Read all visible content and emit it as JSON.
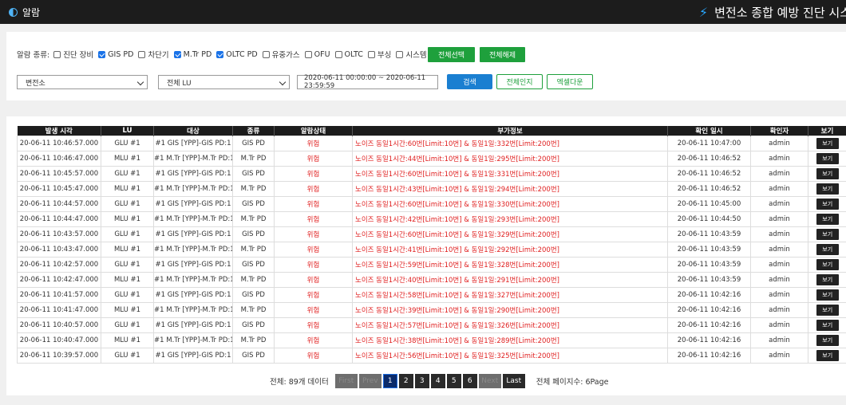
{
  "topbar": {
    "title": "알람",
    "system_title": "변전소 종합 예방 진단 시스"
  },
  "filters": {
    "type_label": "알람 종류:",
    "checkboxes": [
      {
        "label": "진단 장비",
        "checked": false
      },
      {
        "label": "GIS PD",
        "checked": true
      },
      {
        "label": "차단기",
        "checked": false
      },
      {
        "label": "M.Tr PD",
        "checked": true
      },
      {
        "label": "OLTC PD",
        "checked": true
      },
      {
        "label": "유중가스",
        "checked": false
      },
      {
        "label": "OFU",
        "checked": false
      },
      {
        "label": "OLTC",
        "checked": false
      },
      {
        "label": "부싱",
        "checked": false
      },
      {
        "label": "시스템",
        "checked": false
      }
    ],
    "select_all_label": "전체선택",
    "deselect_all_label": "전체해제",
    "substation_value": "변전소",
    "lu_value": "전체 LU",
    "date_range": "2020-06-11 00:00:00 ~ 2020-06-11 23:59:59",
    "search_label": "검색",
    "ack_all_label": "전체인지",
    "excel_label": "엑셀다운"
  },
  "table": {
    "headers": [
      "발생 시각",
      "LU",
      "대상",
      "종류",
      "알람상태",
      "부가정보",
      "확인 일시",
      "확인자",
      "보기"
    ],
    "view_label": "보기",
    "rows": [
      {
        "time": "20-06-11 10:46:57.000",
        "lu": "GLU #1",
        "target": "#1 GIS [YPP]-GIS PD:1",
        "kind": "GIS PD",
        "status": "위험",
        "info": "노이즈 동일1시간:60번[Limit:10번] & 동일1일:332번[Limit:200번]",
        "ack_time": "20-06-11 10:47:00",
        "ack_user": "admin"
      },
      {
        "time": "20-06-11 10:46:47.000",
        "lu": "MLU #1",
        "target": "#1 M.Tr [YPP]-M.Tr PD:1",
        "kind": "M.Tr PD",
        "status": "위험",
        "info": "노이즈 동일1시간:44번[Limit:10번] & 동일1일:295번[Limit:200번]",
        "ack_time": "20-06-11 10:46:52",
        "ack_user": "admin"
      },
      {
        "time": "20-06-11 10:45:57.000",
        "lu": "GLU #1",
        "target": "#1 GIS [YPP]-GIS PD:1",
        "kind": "GIS PD",
        "status": "위험",
        "info": "노이즈 동일1시간:60번[Limit:10번] & 동일1일:331번[Limit:200번]",
        "ack_time": "20-06-11 10:46:52",
        "ack_user": "admin"
      },
      {
        "time": "20-06-11 10:45:47.000",
        "lu": "MLU #1",
        "target": "#1 M.Tr [YPP]-M.Tr PD:1",
        "kind": "M.Tr PD",
        "status": "위험",
        "info": "노이즈 동일1시간:43번[Limit:10번] & 동일1일:294번[Limit:200번]",
        "ack_time": "20-06-11 10:46:52",
        "ack_user": "admin"
      },
      {
        "time": "20-06-11 10:44:57.000",
        "lu": "GLU #1",
        "target": "#1 GIS [YPP]-GIS PD:1",
        "kind": "GIS PD",
        "status": "위험",
        "info": "노이즈 동일1시간:60번[Limit:10번] & 동일1일:330번[Limit:200번]",
        "ack_time": "20-06-11 10:45:00",
        "ack_user": "admin"
      },
      {
        "time": "20-06-11 10:44:47.000",
        "lu": "MLU #1",
        "target": "#1 M.Tr [YPP]-M.Tr PD:1",
        "kind": "M.Tr PD",
        "status": "위험",
        "info": "노이즈 동일1시간:42번[Limit:10번] & 동일1일:293번[Limit:200번]",
        "ack_time": "20-06-11 10:44:50",
        "ack_user": "admin"
      },
      {
        "time": "20-06-11 10:43:57.000",
        "lu": "GLU #1",
        "target": "#1 GIS [YPP]-GIS PD:1",
        "kind": "GIS PD",
        "status": "위험",
        "info": "노이즈 동일1시간:60번[Limit:10번] & 동일1일:329번[Limit:200번]",
        "ack_time": "20-06-11 10:43:59",
        "ack_user": "admin"
      },
      {
        "time": "20-06-11 10:43:47.000",
        "lu": "MLU #1",
        "target": "#1 M.Tr [YPP]-M.Tr PD:1",
        "kind": "M.Tr PD",
        "status": "위험",
        "info": "노이즈 동일1시간:41번[Limit:10번] & 동일1일:292번[Limit:200번]",
        "ack_time": "20-06-11 10:43:59",
        "ack_user": "admin"
      },
      {
        "time": "20-06-11 10:42:57.000",
        "lu": "GLU #1",
        "target": "#1 GIS [YPP]-GIS PD:1",
        "kind": "GIS PD",
        "status": "위험",
        "info": "노이즈 동일1시간:59번[Limit:10번] & 동일1일:328번[Limit:200번]",
        "ack_time": "20-06-11 10:43:59",
        "ack_user": "admin"
      },
      {
        "time": "20-06-11 10:42:47.000",
        "lu": "MLU #1",
        "target": "#1 M.Tr [YPP]-M.Tr PD:1",
        "kind": "M.Tr PD",
        "status": "위험",
        "info": "노이즈 동일1시간:40번[Limit:10번] & 동일1일:291번[Limit:200번]",
        "ack_time": "20-06-11 10:43:59",
        "ack_user": "admin"
      },
      {
        "time": "20-06-11 10:41:57.000",
        "lu": "GLU #1",
        "target": "#1 GIS [YPP]-GIS PD:1",
        "kind": "GIS PD",
        "status": "위험",
        "info": "노이즈 동일1시간:58번[Limit:10번] & 동일1일:327번[Limit:200번]",
        "ack_time": "20-06-11 10:42:16",
        "ack_user": "admin"
      },
      {
        "time": "20-06-11 10:41:47.000",
        "lu": "MLU #1",
        "target": "#1 M.Tr [YPP]-M.Tr PD:1",
        "kind": "M.Tr PD",
        "status": "위험",
        "info": "노이즈 동일1시간:39번[Limit:10번] & 동일1일:290번[Limit:200번]",
        "ack_time": "20-06-11 10:42:16",
        "ack_user": "admin"
      },
      {
        "time": "20-06-11 10:40:57.000",
        "lu": "GLU #1",
        "target": "#1 GIS [YPP]-GIS PD:1",
        "kind": "GIS PD",
        "status": "위험",
        "info": "노이즈 동일1시간:57번[Limit:10번] & 동일1일:326번[Limit:200번]",
        "ack_time": "20-06-11 10:42:16",
        "ack_user": "admin"
      },
      {
        "time": "20-06-11 10:40:47.000",
        "lu": "MLU #1",
        "target": "#1 M.Tr [YPP]-M.Tr PD:1",
        "kind": "M.Tr PD",
        "status": "위험",
        "info": "노이즈 동일1시간:38번[Limit:10번] & 동일1일:289번[Limit:200번]",
        "ack_time": "20-06-11 10:42:16",
        "ack_user": "admin"
      },
      {
        "time": "20-06-11 10:39:57.000",
        "lu": "GLU #1",
        "target": "#1 GIS [YPP]-GIS PD:1",
        "kind": "GIS PD",
        "status": "위험",
        "info": "노이즈 동일1시간:56번[Limit:10번] & 동일1일:325번[Limit:200번]",
        "ack_time": "20-06-11 10:42:16",
        "ack_user": "admin"
      }
    ]
  },
  "pager": {
    "total_text": "전체: 89개 데이터",
    "first_label": "First",
    "prev_label": "Prev",
    "pages": [
      "1",
      "2",
      "3",
      "4",
      "5",
      "6"
    ],
    "current_page": "1",
    "next_label": "Next",
    "last_label": "Last",
    "page_count_text": "전체 페이지수: 6Page"
  }
}
